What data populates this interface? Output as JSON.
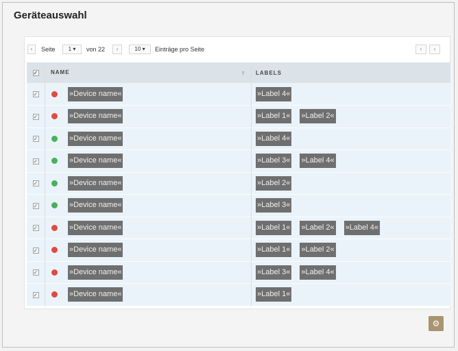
{
  "title": "Geräteauswahl",
  "pager": {
    "prev_glyph": "‹",
    "page_label": "Seite",
    "page_value": "1",
    "of_label": "von 22",
    "next_glyph": "›",
    "per_page_value": "10",
    "per_page_label": "Einträge pro Seite",
    "dropdown_glyph": "▾"
  },
  "table": {
    "headers": {
      "name": "NAME",
      "labels": "LABELS",
      "sort_glyph": "↑"
    },
    "rows": [
      {
        "status": "red",
        "name": "»Device name«",
        "labels": [
          "»Label 4«"
        ]
      },
      {
        "status": "red",
        "name": "»Device name«",
        "labels": [
          "»Label 1«",
          "»Label 2«"
        ]
      },
      {
        "status": "green",
        "name": "»Device name«",
        "labels": [
          "»Label 4«"
        ]
      },
      {
        "status": "green",
        "name": "»Device name«",
        "labels": [
          "»Label 3«",
          "»Label 4«"
        ]
      },
      {
        "status": "green",
        "name": "»Device name«",
        "labels": [
          "»Label 2«"
        ]
      },
      {
        "status": "green",
        "name": "»Device name«",
        "labels": [
          "»Label 3«"
        ]
      },
      {
        "status": "red",
        "name": "»Device name«",
        "labels": [
          "»Label 1«",
          "»Label 2«",
          "»Label 4«"
        ]
      },
      {
        "status": "red",
        "name": "»Device name«",
        "labels": [
          "»Label 1«",
          "»Label 2«"
        ]
      },
      {
        "status": "red",
        "name": "»Device name«",
        "labels": [
          "»Label 3«",
          "»Label 4«"
        ]
      },
      {
        "status": "red",
        "name": "»Device name«",
        "labels": [
          "»Label 1«"
        ]
      }
    ]
  },
  "colors": {
    "red": "#e04a3f",
    "green": "#4cae5c",
    "tag_bg": "#6f6f6f",
    "gear_bg": "#a8956f"
  },
  "icons": {
    "gear": "gear-icon",
    "checkbox": "checkbox-icon",
    "sort": "sort-arrow-icon"
  },
  "gear_glyph": "⚙",
  "check_glyph": "✓"
}
